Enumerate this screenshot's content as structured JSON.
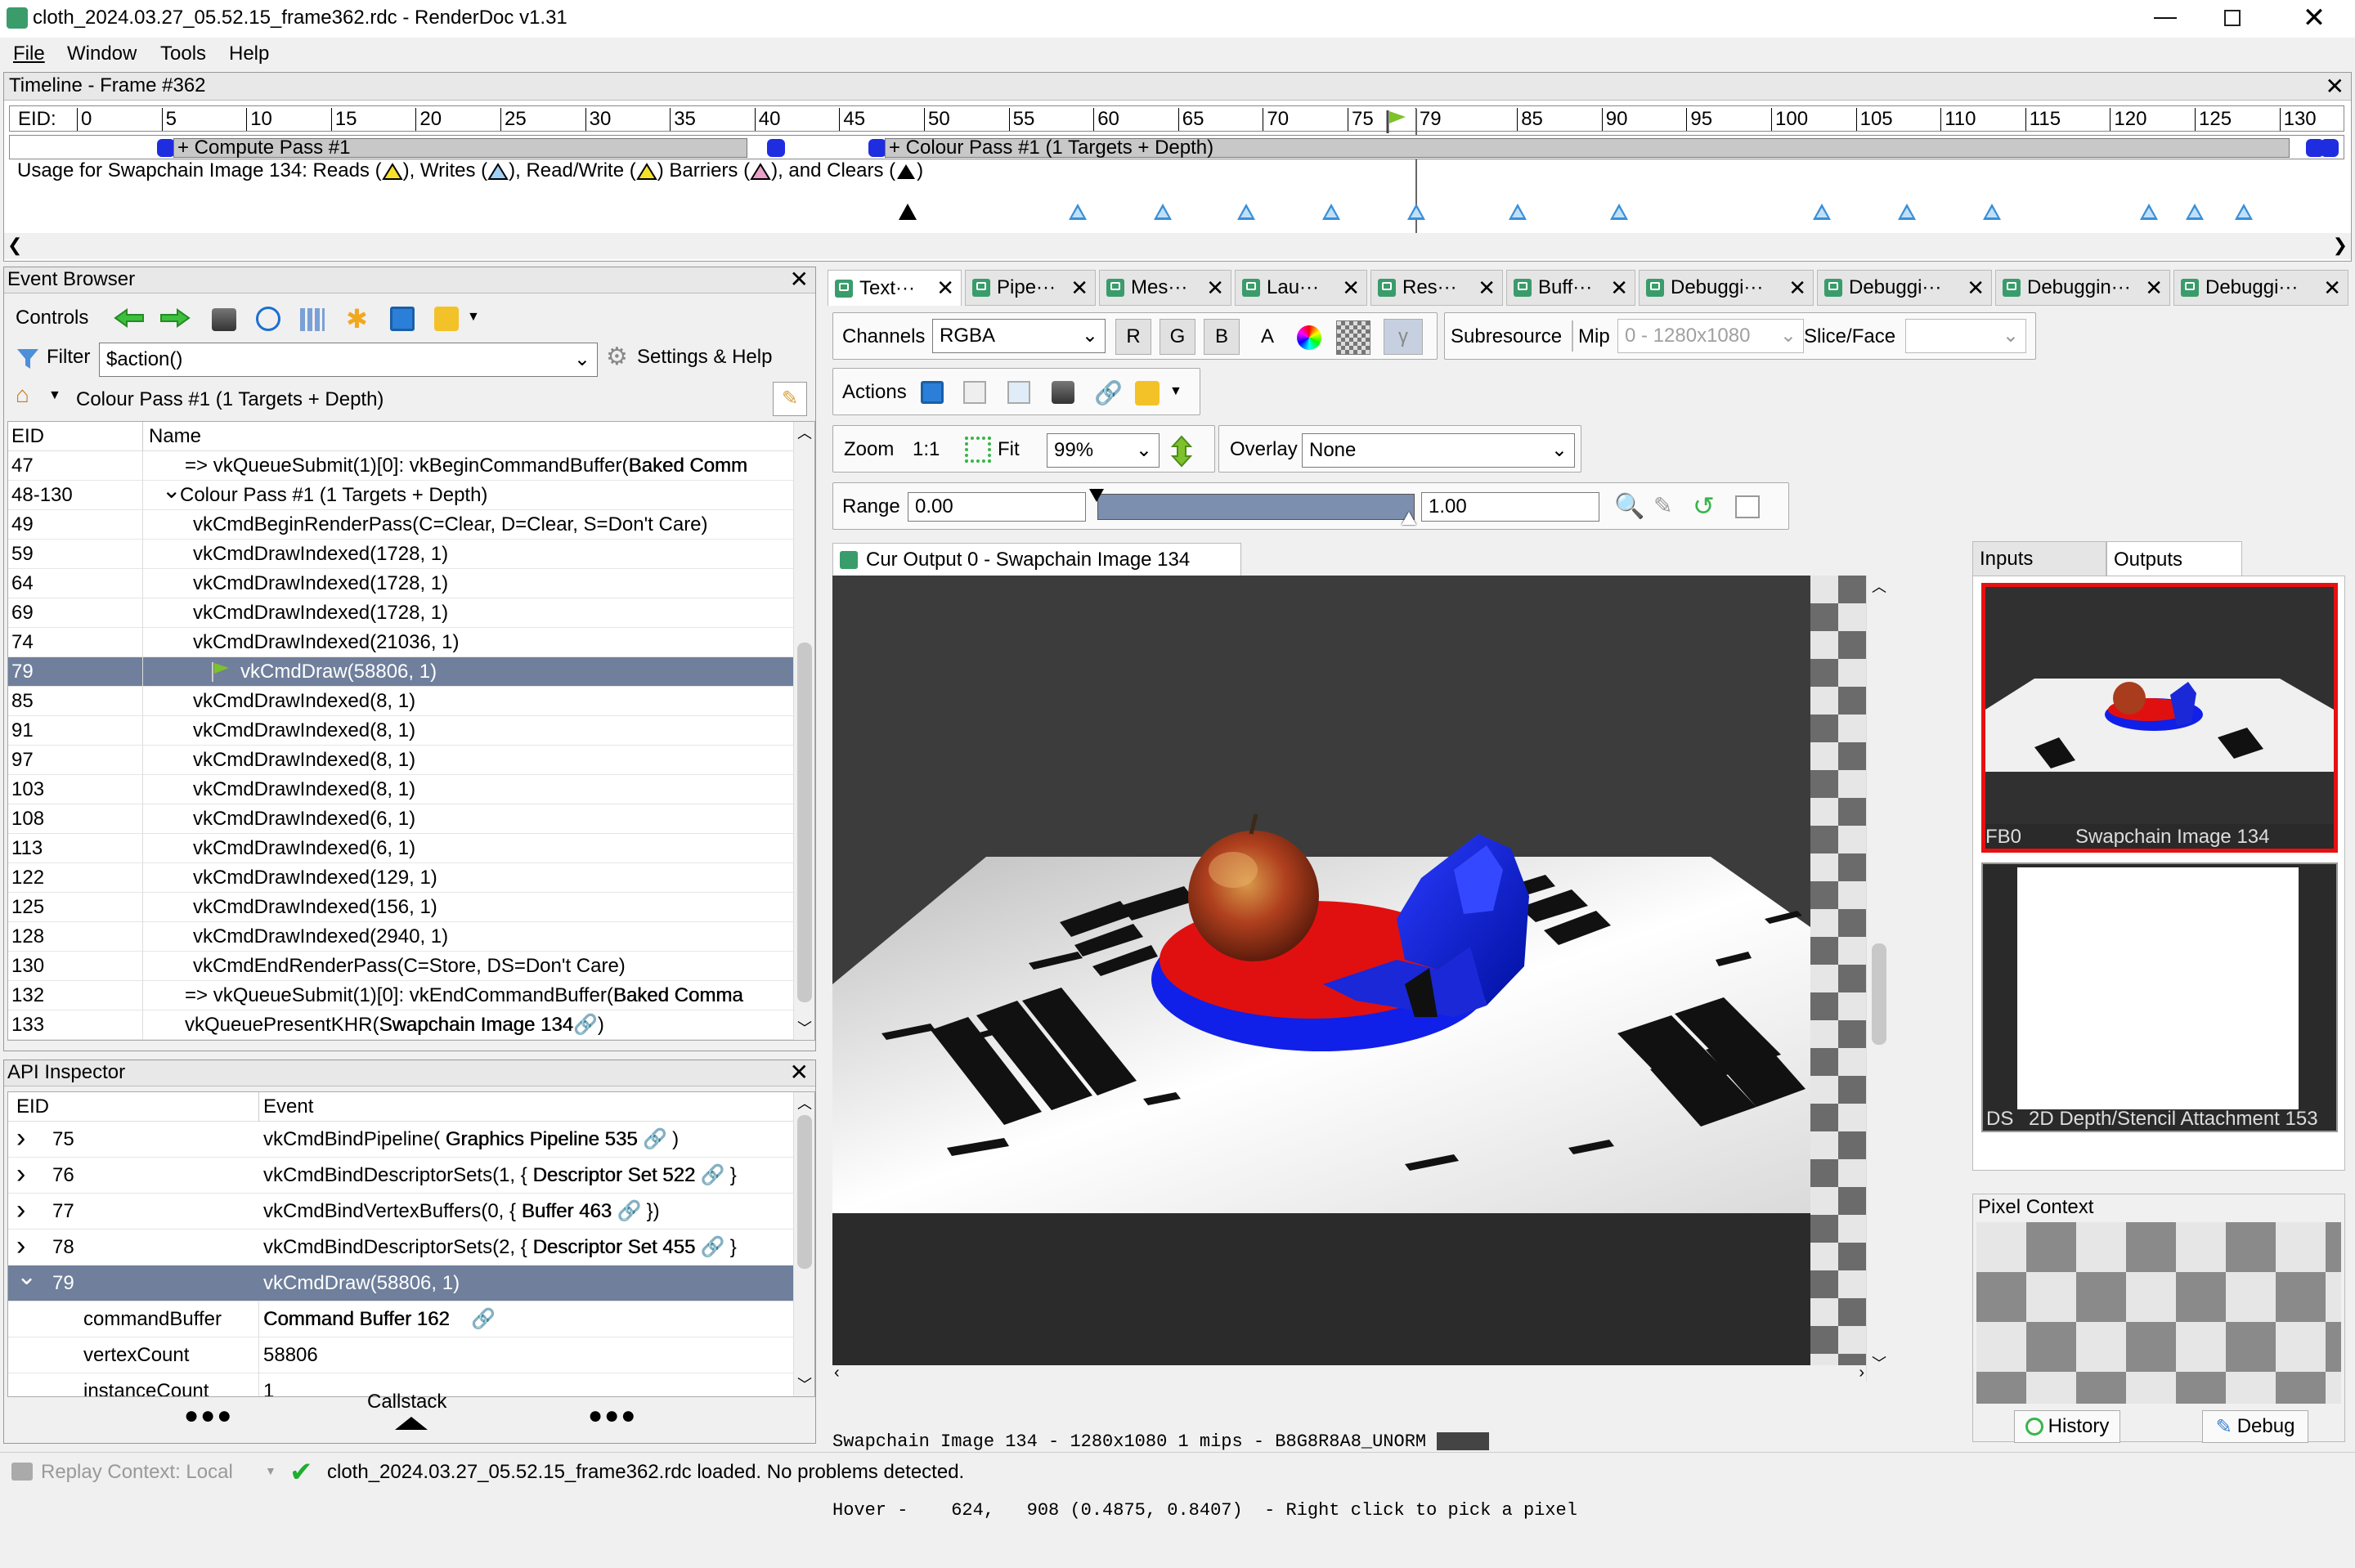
{
  "window": {
    "title": "cloth_2024.03.27_05.52.15_frame362.rdc - RenderDoc v1.31"
  },
  "menu": [
    "File",
    "Window",
    "Tools",
    "Help"
  ],
  "timeline": {
    "title": "Timeline - Frame #362",
    "eid_label": "EID:",
    "ticks": [
      "0",
      "5",
      "10",
      "15",
      "20",
      "25",
      "30",
      "35",
      "40",
      "45",
      "50",
      "55",
      "60",
      "65",
      "70",
      "75",
      "79",
      "85",
      "90",
      "95",
      "100",
      "105",
      "110",
      "115",
      "120",
      "125",
      "130"
    ],
    "passes": [
      "+ Compute Pass #1",
      "+ Colour Pass #1 (1 Targets + Depth)"
    ],
    "usage_text": [
      "Usage for Swapchain Image 134: Reads (",
      "), Writes (",
      "), Read/Write (",
      ") Barriers (",
      "), and Clears (",
      ")"
    ]
  },
  "event_browser": {
    "title": "Event Browser",
    "controls_label": "Controls",
    "filter_label": "Filter",
    "filter_value": "$action()",
    "settings_label": "Settings & Help",
    "breadcrumb": "Colour Pass #1 (1 Targets + Depth)",
    "columns": [
      "EID",
      "Name"
    ],
    "rows": [
      {
        "eid": "47",
        "name": "=> vkQueueSubmit(1)[0]: vkBeginCommandBuffer(",
        "bold": "Baked Comm"
      },
      {
        "eid": "48-130",
        "name": "Colour Pass #1 (1 Targets + Depth)",
        "bold": ""
      },
      {
        "eid": "49",
        "name": "vkCmdBeginRenderPass(C=Clear, D=Clear, S=Don't Care)",
        "bold": ""
      },
      {
        "eid": "59",
        "name": "vkCmdDrawIndexed(1728, 1)",
        "bold": ""
      },
      {
        "eid": "64",
        "name": "vkCmdDrawIndexed(1728, 1)",
        "bold": ""
      },
      {
        "eid": "69",
        "name": "vkCmdDrawIndexed(1728, 1)",
        "bold": ""
      },
      {
        "eid": "74",
        "name": "vkCmdDrawIndexed(21036, 1)",
        "bold": ""
      },
      {
        "eid": "79",
        "name": "vkCmdDraw(58806, 1)",
        "bold": ""
      },
      {
        "eid": "85",
        "name": "vkCmdDrawIndexed(8, 1)",
        "bold": ""
      },
      {
        "eid": "91",
        "name": "vkCmdDrawIndexed(8, 1)",
        "bold": ""
      },
      {
        "eid": "97",
        "name": "vkCmdDrawIndexed(8, 1)",
        "bold": ""
      },
      {
        "eid": "103",
        "name": "vkCmdDrawIndexed(8, 1)",
        "bold": ""
      },
      {
        "eid": "108",
        "name": "vkCmdDrawIndexed(6, 1)",
        "bold": ""
      },
      {
        "eid": "113",
        "name": "vkCmdDrawIndexed(6, 1)",
        "bold": ""
      },
      {
        "eid": "122",
        "name": "vkCmdDrawIndexed(129, 1)",
        "bold": ""
      },
      {
        "eid": "125",
        "name": "vkCmdDrawIndexed(156, 1)",
        "bold": ""
      },
      {
        "eid": "128",
        "name": "vkCmdDrawIndexed(2940, 1)",
        "bold": ""
      },
      {
        "eid": "130",
        "name": "vkCmdEndRenderPass(C=Store, DS=Don't Care)",
        "bold": ""
      },
      {
        "eid": "132",
        "name": "=> vkQueueSubmit(1)[0]: vkEndCommandBuffer(",
        "bold": "Baked Comma"
      },
      {
        "eid": "133",
        "name": "vkQueuePresentKHR(",
        "bold": "Swapchain Image 134",
        "tail": ")"
      }
    ]
  },
  "api_inspector": {
    "title": "API Inspector",
    "columns": [
      "EID",
      "Event"
    ],
    "rows": [
      {
        "eid": "75",
        "pre": "vkCmdBindPipeline(",
        "bold": "Graphics Pipeline 535",
        "post": ")"
      },
      {
        "eid": "76",
        "pre": "vkCmdBindDescriptorSets(1, {",
        "bold": "Descriptor Set 522",
        "post": "}"
      },
      {
        "eid": "77",
        "pre": "vkCmdBindVertexBuffers(0, {",
        "bold": "Buffer 463",
        "post": "})"
      },
      {
        "eid": "78",
        "pre": "vkCmdBindDescriptorSets(2, {",
        "bold": "Descriptor Set 455",
        "post": "}"
      },
      {
        "eid": "79",
        "pre": "vkCmdDraw(58806, 1)",
        "bold": "",
        "post": ""
      }
    ],
    "params": [
      {
        "name": "commandBuffer",
        "value": "Command Buffer 162",
        "bold": true
      },
      {
        "name": "vertexCount",
        "value": "58806",
        "bold": false
      },
      {
        "name": "instanceCount",
        "value": "1",
        "bold": false
      }
    ],
    "callstack_label": "Callstack"
  },
  "tabs": [
    "Text···",
    "Pipe···",
    "Mes···",
    "Lau···",
    "Res···",
    "Buff···",
    "Debuggi···",
    "Debuggi···",
    "Debuggin···",
    "Debuggi···"
  ],
  "texture_viewer": {
    "channels_label": "Channels",
    "channels_value": "RGBA",
    "channel_buttons": [
      "R",
      "G",
      "B",
      "A"
    ],
    "gamma": "γ",
    "subresource_label": "Subresource",
    "mip_label": "Mip",
    "mip_value": "0 - 1280x1080",
    "slice_label": "Slice/Face",
    "actions_label": "Actions",
    "zoom_label": "Zoom",
    "zoom_11": "1:1",
    "fit_label": "Fit",
    "zoom_value": "99%",
    "overlay_label": "Overlay",
    "overlay_value": "None",
    "range_label": "Range",
    "range_min": "0.00",
    "range_max": "1.00",
    "output_tab": "Cur Output 0 - Swapchain Image 134",
    "status_line1": "Swapchain Image 134 - 1280x1080 1 mips - B8G8R8A8_UNORM",
    "status_line2": "Hover -    624,   908 (0.4875, 0.8407)  - Right click to pick a pixel"
  },
  "side_panel": {
    "tabs": [
      "Inputs",
      "Outputs"
    ],
    "thumbs": [
      {
        "slot": "FB0",
        "name": "Swapchain Image 134"
      },
      {
        "slot": "DS",
        "name": "2D Depth/Stencil Attachment 153"
      }
    ],
    "pixel_context_title": "Pixel Context",
    "history_label": "History",
    "debug_label": "Debug"
  },
  "status_bar": {
    "replay_context": "Replay Context: Local",
    "message": "cloth_2024.03.27_05.52.15_frame362.rdc loaded. No problems detected."
  },
  "colors": {
    "accent": "#3a9c6b",
    "selection": "#6f7f9c",
    "red_outline": "#e81010"
  }
}
